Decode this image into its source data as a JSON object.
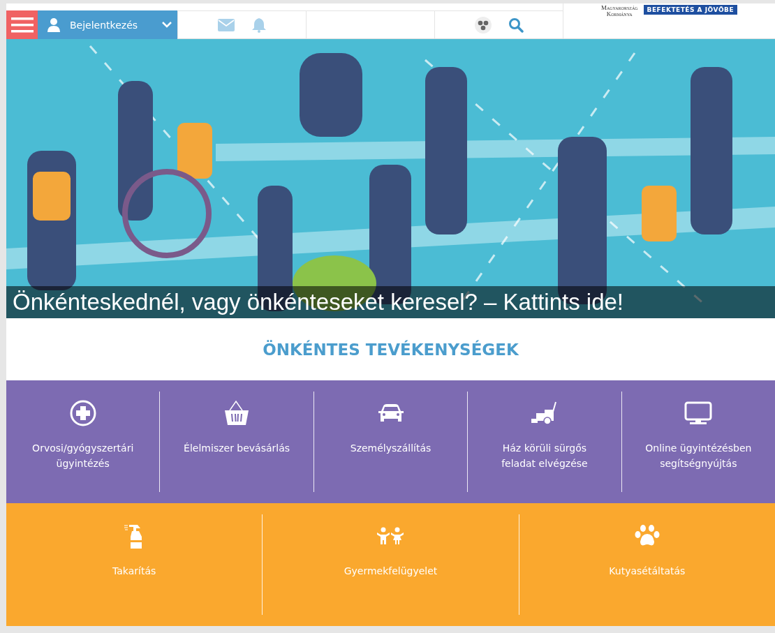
{
  "header": {
    "login": {
      "label": "Bejelentkezés"
    },
    "logo": {
      "line_1": "Magyarország",
      "line_2": "Kormánya",
      "badge": "BEFEKTETÉS A JÖVŐBE"
    }
  },
  "hero": {
    "caption": "Önkénteskednél, vagy önkénteseket keresel? – Kattints ide!"
  },
  "section_title": "ÖNKÉNTES TEVÉKENYSÉGEK",
  "activity_rows": [
    {
      "color": "#7d6bb2",
      "tiles": [
        {
          "kind": "medical",
          "label": "Orvosi/gyógyszertári ügyintézés"
        },
        {
          "kind": "basket",
          "label": "Élelmiszer bevásárlás"
        },
        {
          "kind": "car",
          "label": "Személyszállítás"
        },
        {
          "kind": "mower",
          "label": "Ház körüli sürgős feladat elvégzése"
        },
        {
          "kind": "monitor",
          "label": "Online ügyintézésben segítségnyújtás"
        }
      ]
    },
    {
      "color": "#faa82e",
      "tiles": [
        {
          "kind": "spray",
          "label": "Takarítás"
        },
        {
          "kind": "children",
          "label": "Gyermekfelügyelet"
        },
        {
          "kind": "paw",
          "label": "Kutyasétáltatás"
        }
      ]
    }
  ]
}
